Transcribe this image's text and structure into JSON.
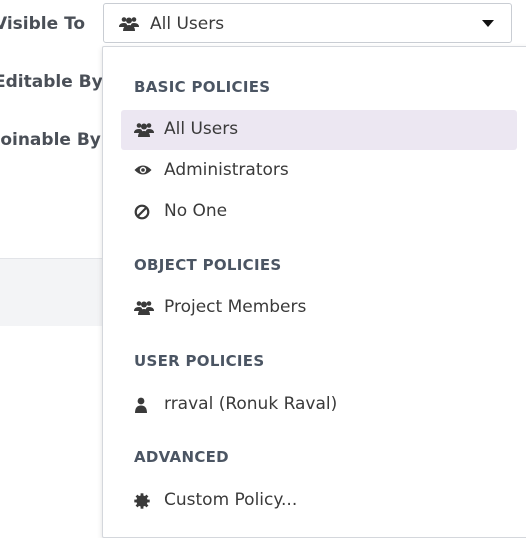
{
  "form": {
    "visible_label": "Visible To",
    "editable_label": "Editable By",
    "joinable_label": "Joinable By"
  },
  "select": {
    "value": "All Users",
    "icon": "users-icon"
  },
  "menu": {
    "basic_header": "BASIC POLICIES",
    "basic_items": [
      {
        "label": "All Users",
        "icon": "users-icon",
        "selected": true
      },
      {
        "label": "Administrators",
        "icon": "eye-icon"
      },
      {
        "label": "No One",
        "icon": "ban-icon"
      }
    ],
    "object_header": "OBJECT POLICIES",
    "object_items": [
      {
        "label": "Project Members",
        "icon": "users-icon"
      }
    ],
    "user_header": "USER POLICIES",
    "user_items": [
      {
        "label": "rraval (Ronuk Raval)",
        "icon": "user-icon"
      }
    ],
    "advanced_header": "ADVANCED",
    "advanced_items": [
      {
        "label": "Custom Policy...",
        "icon": "gear-icon"
      }
    ]
  },
  "colors": {
    "selected_bg": "#ece7f2",
    "header_text": "#4b5563",
    "panel_band": "#f3f4f6"
  }
}
